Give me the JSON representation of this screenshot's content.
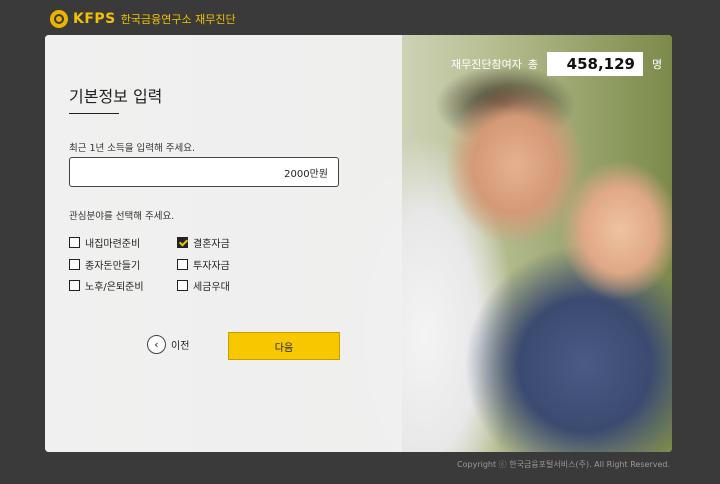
{
  "header": {
    "brand": "KFPS",
    "subtitle": "한국금융연구소 재무진단"
  },
  "participants": {
    "label": "재무진단참여자",
    "prefix": "총",
    "count": "458,129",
    "unit": "명"
  },
  "form": {
    "title": "기본정보 입력",
    "income_label": "최근 1년 소득을 입력해 주세요.",
    "income_value": "2000만원",
    "interest_label": "관심분야를 선택해 주세요.",
    "options": [
      {
        "label": "내집마련준비",
        "checked": false
      },
      {
        "label": "결혼자금",
        "checked": true
      },
      {
        "label": "종자돈만들기",
        "checked": false
      },
      {
        "label": "투자자금",
        "checked": false
      },
      {
        "label": "노후/은퇴준비",
        "checked": false
      },
      {
        "label": "세금우대",
        "checked": false
      }
    ],
    "prev_label": "이전",
    "next_label": "다음"
  },
  "footer": {
    "copyright": "Copyright ⓒ 한국금융포털서비스(주). All Right Reserved."
  },
  "colors": {
    "accent": "#f7c800",
    "background": "#3a3a3a"
  }
}
